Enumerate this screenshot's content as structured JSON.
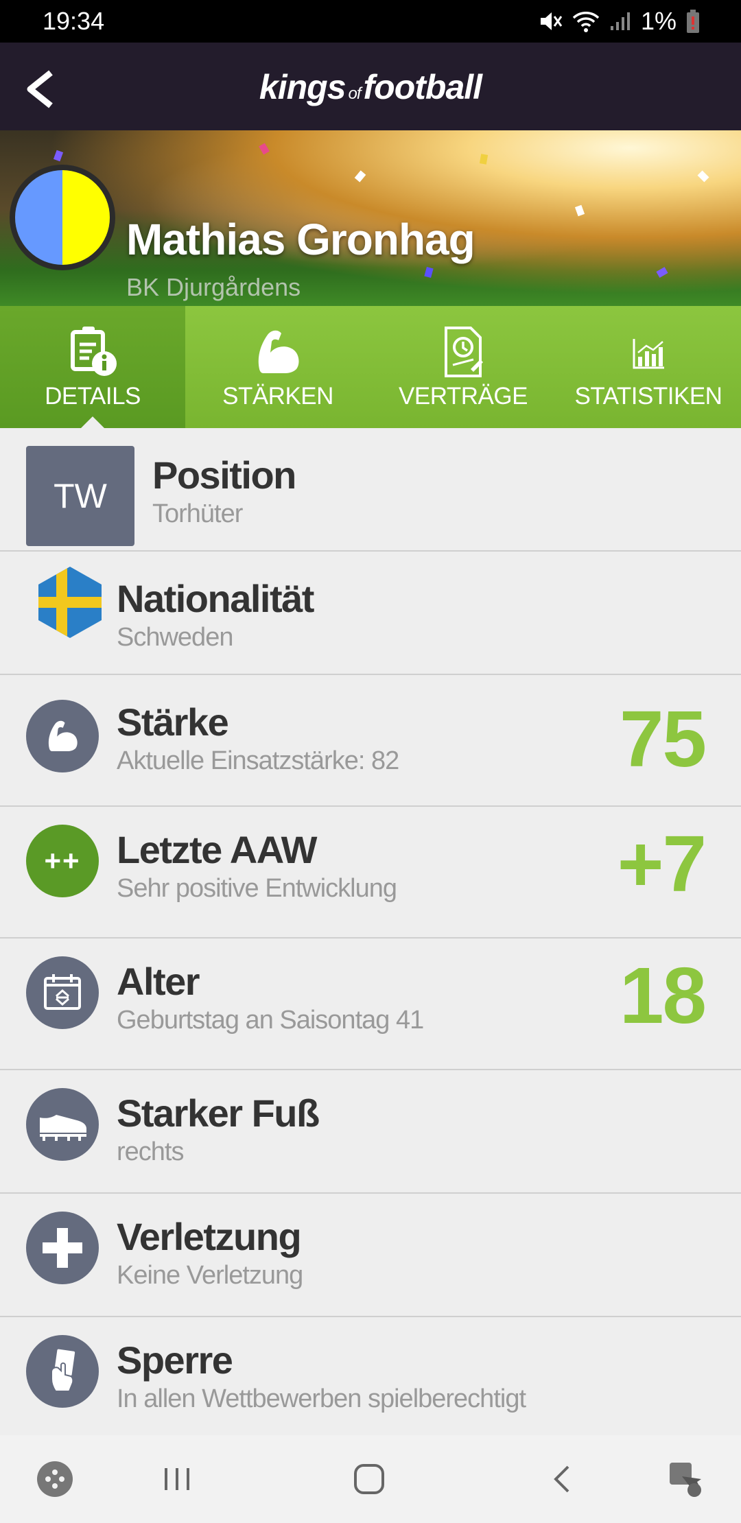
{
  "status_bar": {
    "time": "19:34",
    "battery": "1%"
  },
  "app": {
    "logo_main_1": "kings",
    "logo_of": "of",
    "logo_main_2": "football"
  },
  "player": {
    "name": "Mathias Gronhag",
    "club": "BK Djurgårdens",
    "crest_colors": [
      "#6699ff",
      "#ffff00"
    ]
  },
  "tabs": [
    {
      "label": "DETAILS",
      "icon": "document-info-icon",
      "active": true
    },
    {
      "label": "STÄRKEN",
      "icon": "flexed-arm-icon",
      "active": false
    },
    {
      "label": "VERTRÄGE",
      "icon": "contract-clock-icon",
      "active": false
    },
    {
      "label": "STATISTIKEN",
      "icon": "bar-chart-icon",
      "active": false
    }
  ],
  "details": {
    "position": {
      "badge": "TW",
      "title": "Position",
      "subtitle": "Torhüter"
    },
    "nationality": {
      "title": "Nationalität",
      "subtitle": "Schweden",
      "icon": "sweden-flag-icon"
    },
    "strength": {
      "title": "Stärke",
      "subtitle": "Aktuelle Einsatzstärke: 82",
      "value": "75",
      "icon": "flexed-arm-icon"
    },
    "last_aaw": {
      "title": "Letzte AAW",
      "subtitle": "Sehr positive Entwicklung",
      "value": "+7",
      "icon": "plus-plus-icon",
      "icon_text": "++"
    },
    "age": {
      "title": "Alter",
      "subtitle": "Geburtstag an Saisontag 41",
      "value": "18",
      "icon": "calendar-icon"
    },
    "strong_foot": {
      "title": "Starker Fuß",
      "subtitle": "rechts",
      "icon": "football-boot-icon"
    },
    "injury": {
      "title": "Verletzung",
      "subtitle": "Keine Verletzung",
      "icon": "medical-cross-icon"
    },
    "suspension": {
      "title": "Sperre",
      "subtitle": "In allen Wettbewerben spielberechtigt",
      "icon": "referee-card-icon"
    }
  },
  "colors": {
    "accent_green": "#8dc63f",
    "tab_bar": "#79b530",
    "header": "#231c2c",
    "icon_bg": "#646b7e"
  }
}
